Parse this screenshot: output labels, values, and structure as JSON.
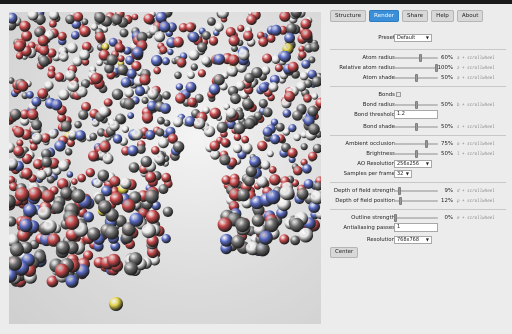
{
  "tabs": [
    {
      "label": "Structure",
      "active": false
    },
    {
      "label": "Render",
      "active": true
    },
    {
      "label": "Share",
      "active": false
    },
    {
      "label": "Help",
      "active": false
    },
    {
      "label": "About",
      "active": false
    }
  ],
  "preset": {
    "label": "Preset",
    "value": "Default"
  },
  "atom": {
    "radius": {
      "label": "Atom radius",
      "value": "60%",
      "level": 0.6,
      "hint": "a + scrollwheel"
    },
    "relative": {
      "label": "Relative atom radius",
      "value": "100%",
      "level": 1.0,
      "hint": "z + scrollwheel"
    },
    "shade": {
      "label": "Atom shade",
      "value": "50%",
      "level": 0.5,
      "hint": "a + scrollwheel"
    }
  },
  "bonds": {
    "label": "Bonds",
    "radius": {
      "label": "Bond radius",
      "value": "50%",
      "level": 0.5,
      "hint": "b + scrollwheel"
    },
    "threshold": {
      "label": "Bond threshold",
      "value": "1.2"
    },
    "shade": {
      "label": "Bond shade",
      "value": "50%",
      "level": 0.5,
      "hint": "s + scrollwheel"
    }
  },
  "lighting": {
    "ao": {
      "label": "Ambient occlusion",
      "value": "75%",
      "level": 0.75,
      "hint": "o + scrollwheel"
    },
    "brightness": {
      "label": "Brightness",
      "value": "50%",
      "level": 0.5,
      "hint": "l + scrollwheel"
    },
    "ao_res": {
      "label": "AO Resolution",
      "value": "256x256"
    },
    "spf": {
      "label": "Samples per frame",
      "value": "32"
    }
  },
  "dof": {
    "strength": {
      "label": "Depth of field strength",
      "value": "9%",
      "level": 0.09,
      "hint": "d + scrollwheel"
    },
    "position": {
      "label": "Depth of field position",
      "value": "12%",
      "level": 0.12,
      "hint": "p + scrollwheel"
    }
  },
  "output": {
    "outline": {
      "label": "Outline strength",
      "value": "0%",
      "level": 0.0,
      "hint": "e + scrollwheel"
    },
    "aa": {
      "label": "Antialiasing passes",
      "value": "1"
    },
    "res": {
      "label": "Resolution",
      "value": "768x768"
    }
  },
  "center_label": "Center",
  "colors": {
    "accent": "#3b8fd9",
    "oxygen": "#c9484a",
    "nitrogen": "#5a6bc4",
    "carbon": "#6e6e6e",
    "hydrogen": "#e9e9e9",
    "sulfur": "#e3d24a"
  }
}
